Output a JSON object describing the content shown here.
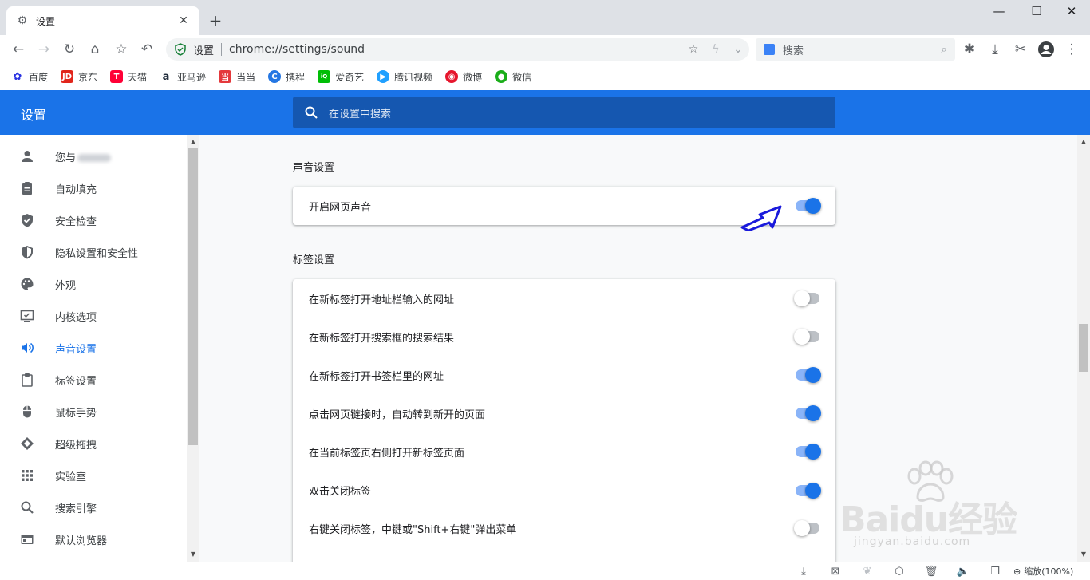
{
  "browser": {
    "tab": {
      "title": "设置",
      "icon": "gear-icon"
    },
    "omnibox": {
      "site": "设置",
      "url": "chrome://settings/sound"
    },
    "search": {
      "placeholder": "搜索"
    }
  },
  "bookmarks": [
    {
      "label": "百度",
      "icon": "baidu-paw-icon",
      "color": "#2932e1"
    },
    {
      "label": "京东",
      "icon": "jd-icon",
      "color": "#e1251b"
    },
    {
      "label": "天猫",
      "icon": "tmall-icon",
      "color": "#ff0036"
    },
    {
      "label": "亚马逊",
      "icon": "amazon-icon",
      "color": "#232f3e"
    },
    {
      "label": "当当",
      "icon": "dangdang-icon",
      "color": "#e4393c"
    },
    {
      "label": "携程",
      "icon": "ctrip-icon",
      "color": "#2577e3"
    },
    {
      "label": "爱奇艺",
      "icon": "iqiyi-icon",
      "color": "#00be06"
    },
    {
      "label": "腾讯视频",
      "icon": "tencent-video-icon",
      "color": "#20a0ff"
    },
    {
      "label": "微博",
      "icon": "weibo-icon",
      "color": "#e6162d"
    },
    {
      "label": "微信",
      "icon": "wechat-icon",
      "color": "#1aad19"
    }
  ],
  "settings": {
    "title": "设置",
    "search_placeholder": "在设置中搜索",
    "nav": [
      {
        "label": "您与",
        "icon": "person-icon",
        "active": false
      },
      {
        "label": "自动填充",
        "icon": "clipboard-icon",
        "active": false
      },
      {
        "label": "安全检查",
        "icon": "shield-check-icon",
        "active": false
      },
      {
        "label": "隐私设置和安全性",
        "icon": "shield-icon",
        "active": false
      },
      {
        "label": "外观",
        "icon": "palette-icon",
        "active": false
      },
      {
        "label": "内核选项",
        "icon": "monitor-icon",
        "active": false
      },
      {
        "label": "声音设置",
        "icon": "speaker-icon",
        "active": true
      },
      {
        "label": "标签设置",
        "icon": "tab-icon",
        "active": false
      },
      {
        "label": "鼠标手势",
        "icon": "mouse-icon",
        "active": false
      },
      {
        "label": "超级拖拽",
        "icon": "drag-icon",
        "active": false
      },
      {
        "label": "实验室",
        "icon": "grid-icon",
        "active": false
      },
      {
        "label": "搜索引擎",
        "icon": "search-icon",
        "active": false
      },
      {
        "label": "默认浏览器",
        "icon": "browser-icon",
        "active": false
      }
    ],
    "sound_section": {
      "title": "声音设置",
      "items": [
        {
          "label": "开启网页声音",
          "on": true
        }
      ]
    },
    "tab_section": {
      "title": "标签设置",
      "items": [
        {
          "label": "在新标签打开地址栏输入的网址",
          "on": false
        },
        {
          "label": "在新标签打开搜索框的搜索结果",
          "on": false
        },
        {
          "label": "在新标签打开书签栏里的网址",
          "on": true
        },
        {
          "label": "点击网页链接时，自动转到新开的页面",
          "on": true
        },
        {
          "label": "在当前标签页右侧打开新标签页面",
          "on": true
        },
        {
          "label": "双击关闭标签",
          "on": true
        },
        {
          "label": "右键关闭标签，中键或\"Shift+右键\"弹出菜单",
          "on": false
        }
      ]
    }
  },
  "statusbar": {
    "zoom": "缩放(100%)"
  },
  "watermark": {
    "main": "Baidu经验",
    "sub": "jingyan.baidu.com"
  }
}
